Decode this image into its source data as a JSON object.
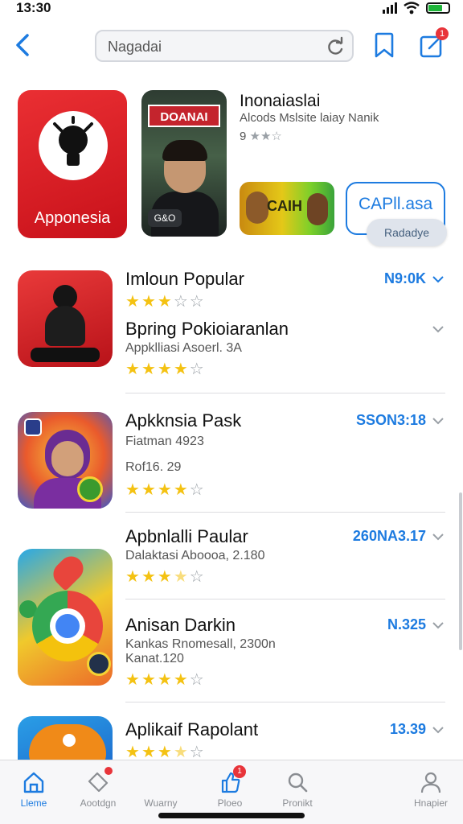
{
  "status_bar": {
    "time": "13:30"
  },
  "search": {
    "placeholder": "Nagadai"
  },
  "nav": {
    "compose_badge": "1"
  },
  "featured": {
    "main_label": "Apponesia",
    "photo_banner": "DOANAI",
    "photo_badge": "G&O",
    "title": "Inonaiaslai",
    "subtitle": "Alcods Mslsite laiay Nanik",
    "rating_text": "9",
    "card_label": "CAIH",
    "button_label": "CAPll.asa",
    "pill_label": "Radadye"
  },
  "apps": [
    {
      "name": "Imloun Popular",
      "price": "N9:0K",
      "stars_on": 3,
      "stars_total": 5
    },
    {
      "name": "Bpring Pokioiaranlan",
      "sub": "Appklliasi Asoerl. 3A",
      "stars_on": 4,
      "stars_total": 5
    },
    {
      "name": "Apkknsia Pask",
      "sub1": "Fiatman 4923",
      "sub2": "Rof16. 29",
      "price": "SSON3:18",
      "stars_on": 4,
      "stars_total": 5
    },
    {
      "name": "Apbnlalli Paular",
      "sub": "Dalaktasi Aboooa, 2.180",
      "price": "260NA3.17",
      "stars_on": 3.5,
      "stars_total": 5
    },
    {
      "name": "Anisan Darkin",
      "sub1": "Kankas Rnomesall, 2300n",
      "sub2": "Kanat.120",
      "price": "N.325",
      "stars_on": 4,
      "stars_total": 5
    },
    {
      "name": "Aplikaif Rapolant",
      "price": "13.39",
      "stars_on": 3.5,
      "stars_total": 5
    }
  ],
  "tabs": [
    {
      "label": "Lleme",
      "icon": "home-icon"
    },
    {
      "label": "Aootdgn",
      "icon": "tag-icon"
    },
    {
      "label": "Wuarny",
      "icon": "none"
    },
    {
      "label": "Ploeo",
      "icon": "thumbs-up-icon",
      "badge": "1"
    },
    {
      "label": "Pronikt",
      "icon": "search-icon"
    },
    {
      "label": "Hnapier",
      "icon": "person-icon"
    }
  ],
  "colors": {
    "accent": "#1d7be0",
    "star": "#f4c212",
    "brand_red": "#e3262e"
  }
}
